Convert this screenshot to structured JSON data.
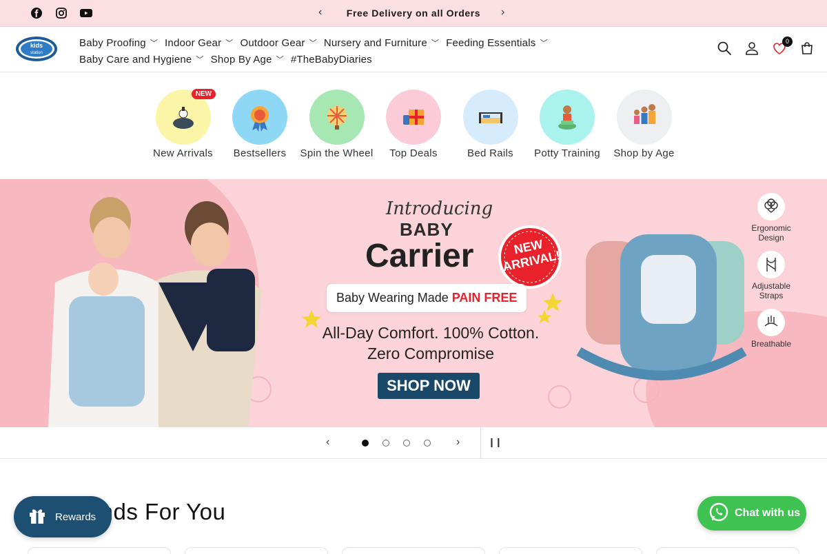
{
  "announcement": {
    "text": "Free Delivery on all Orders",
    "prev_icon": "chevron-left-icon",
    "next_icon": "chevron-right-icon"
  },
  "social": [
    "facebook-icon",
    "instagram-icon",
    "youtube-icon"
  ],
  "brand": {
    "logo_text": "kids station"
  },
  "nav": {
    "row1": [
      {
        "label": "Baby Proofing",
        "has_dropdown": true
      },
      {
        "label": "Indoor Gear",
        "has_dropdown": true
      },
      {
        "label": "Outdoor Gear",
        "has_dropdown": true
      },
      {
        "label": "Nursery and Furniture",
        "has_dropdown": true
      },
      {
        "label": "Feeding Essentials",
        "has_dropdown": true
      }
    ],
    "row2": [
      {
        "label": "Baby Care and Hygiene",
        "has_dropdown": true
      },
      {
        "label": "Shop By Age",
        "has_dropdown": true
      },
      {
        "label": "#TheBabyDiaries",
        "has_dropdown": false
      }
    ]
  },
  "header_icons": {
    "wishlist_count": "0"
  },
  "categories": [
    {
      "label": "New Arrivals",
      "badge": "NEW",
      "color": "#fcf4a6"
    },
    {
      "label": "Bestsellers",
      "color": "#8fd8f5"
    },
    {
      "label": "Spin the Wheel",
      "color": "#a7e7b4"
    },
    {
      "label": "Top Deals",
      "color": "#fbcbd7"
    },
    {
      "label": "Bed Rails",
      "color": "#d6ebfb"
    },
    {
      "label": "Potty Training",
      "color": "#a9f2ee"
    },
    {
      "label": "Shop by Age",
      "color": "#eeeff1"
    }
  ],
  "banner": {
    "intro": "Introducing",
    "baby": "BABY",
    "carrier": "Carrier",
    "new_arrival_1": "NEW",
    "new_arrival_2": "ARRIVAL!",
    "tagline_prefix": "Baby Wearing Made ",
    "tagline_highlight": "PAIN FREE",
    "comfort_line1": "All-Day Comfort. 100% Cotton.",
    "comfort_line2": "Zero Compromise",
    "cta": "SHOP NOW",
    "features": [
      {
        "label1": "Ergonomic",
        "label2": "Design",
        "icon": "cotton-icon"
      },
      {
        "label1": "Adjustable",
        "label2": "Straps",
        "icon": "straps-icon"
      },
      {
        "label1": "Breathable",
        "label2": "",
        "icon": "breathable-icon"
      }
    ]
  },
  "slider": {
    "slide_count": 4,
    "active_index": 0
  },
  "section": {
    "title": "New Finds For You"
  },
  "floating": {
    "rewards_label": "Rewards",
    "chat_label": "Chat with us"
  },
  "colors": {
    "announce_bg": "#fcdfe3",
    "banner_bg": "#fbd3d8",
    "cta_bg": "#1a4868",
    "rewards_bg": "#1d4f73",
    "chat_bg": "#3fc252",
    "accent_red": "#e8212a"
  }
}
